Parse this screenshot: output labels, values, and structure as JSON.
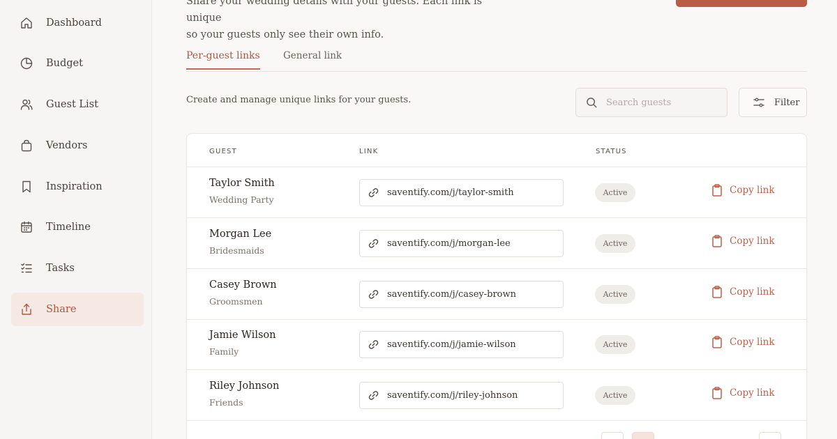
{
  "sidebar": {
    "items": [
      {
        "label": "Dashboard",
        "icon": "home-icon"
      },
      {
        "label": "Budget",
        "icon": "pie-chart-icon"
      },
      {
        "label": "Guest List",
        "icon": "users-icon"
      },
      {
        "label": "Vendors",
        "icon": "shopping-bag-icon"
      },
      {
        "label": "Inspiration",
        "icon": "bookmark-icon"
      },
      {
        "label": "Timeline",
        "icon": "calendar-icon"
      },
      {
        "label": "Tasks",
        "icon": "checklist-icon"
      },
      {
        "label": "Share",
        "icon": "share-icon",
        "active": true
      }
    ]
  },
  "intro": {
    "line1": "Share your wedding details with your guests. Each link is unique",
    "line2": "so your guests only see their own info."
  },
  "tabs": [
    {
      "label": "Per-guest links",
      "active": true
    },
    {
      "label": "General link",
      "active": false
    }
  ],
  "subtitle": "Create and manage unique links for your guests.",
  "search": {
    "placeholder": "Search guests",
    "value": ""
  },
  "filter": {
    "label": "Filter"
  },
  "table": {
    "headers": {
      "guest": "GUEST",
      "link": "LINK",
      "status": "STATUS"
    },
    "rows": [
      {
        "name": "Taylor Smith",
        "group": "Wedding Party",
        "url": "saventify.com/j/taylor-smith",
        "status": "Active",
        "action": "Copy link"
      },
      {
        "name": "Morgan Lee",
        "group": "Bridesmaids",
        "url": "saventify.com/j/morgan-lee",
        "status": "Active",
        "action": "Copy link"
      },
      {
        "name": "Casey Brown",
        "group": "Groomsmen",
        "url": "saventify.com/j/casey-brown",
        "status": "Active",
        "action": "Copy link"
      },
      {
        "name": "Jamie Wilson",
        "group": "Family",
        "url": "saventify.com/j/jamie-wilson",
        "status": "Active",
        "action": "Copy link"
      },
      {
        "name": "Riley Johnson",
        "group": "Friends",
        "url": "saventify.com/j/riley-johnson",
        "status": "Active",
        "action": "Copy link"
      }
    ]
  },
  "colors": {
    "accent": "#b4553e",
    "active_nav_bg": "#f6e9e3",
    "badge_bg": "#efede8",
    "sidebar_bg": "#f7f5f3"
  }
}
